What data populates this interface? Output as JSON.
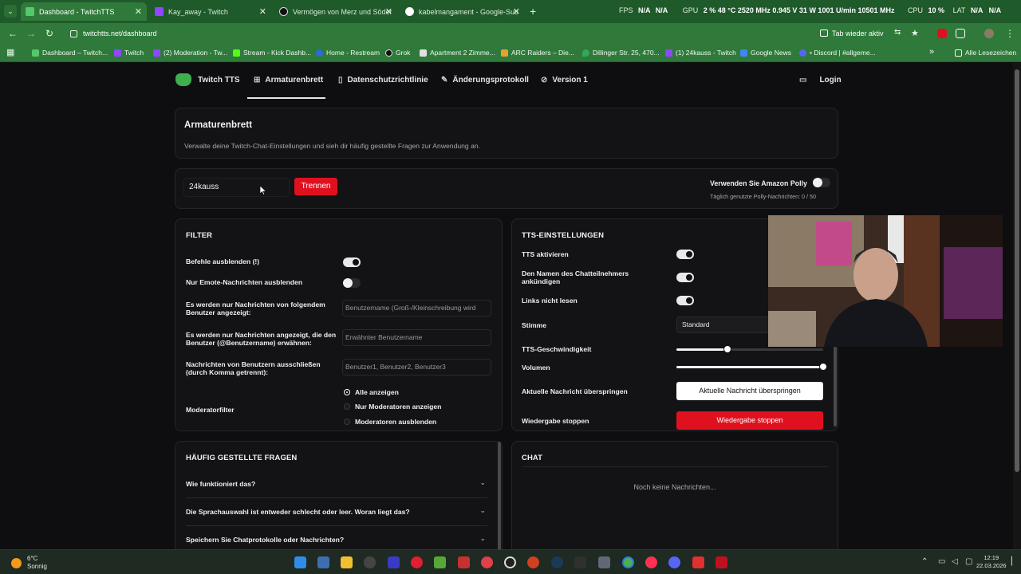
{
  "browser": {
    "tabs": [
      {
        "title": "Dashboard - TwitchTTS",
        "active": true
      },
      {
        "title": "Kay_away - Twitch"
      },
      {
        "title": "Vermögen von Merz und Söder"
      },
      {
        "title": "kabelmangament - Google-Suc"
      }
    ],
    "overlay": {
      "fps_label": "FPS",
      "fps_a": "N/A",
      "fps_b": "N/A",
      "gpu_label": "GPU",
      "gpu_line": "2 %  48 °C  2520 MHz  0.945 V  31 W  1001 U/min  10501 MHz",
      "cpu_label": "CPU",
      "cpu_val": "10 %",
      "lat_label": "LAT",
      "lat_a": "N/A",
      "lat_b": "N/A"
    },
    "url": "twitchtts.net/dashboard",
    "tab_active_label": "Tab wieder aktiv",
    "bookmarks": [
      "Dashboard – Twitch...",
      "Twitch",
      "(2) Moderation - Tw...",
      "Stream - Kick Dashb...",
      "Home - Restream",
      "Grok",
      "Apartment 2 Zimme...",
      "ARC Raiders – Die...",
      "Dillinger Str. 25, 470...",
      "(1) 24kauss - Twitch",
      "Google News",
      "• Discord | #allgeme..."
    ],
    "all_bookmarks": "Alle Lesezeichen"
  },
  "nav": {
    "brand": "Twitch TTS",
    "items": [
      "Armaturenbrett",
      "Datenschutzrichtlinie",
      "Änderungsprotokoll",
      "Version 1"
    ],
    "login": "Login"
  },
  "header": {
    "title": "Armaturenbrett",
    "subtitle": "Verwalte deine Twitch-Chat-Einstellungen und sieh dir häufig gestellte Fragen zur Anwendung an."
  },
  "connect": {
    "channel_value": "24kauss",
    "disconnect_label": "Trennen",
    "polly_label": "Verwenden Sie Amazon Polly",
    "polly_usage": "Täglich genutzte Polly-Nachrichten: 0 / 50"
  },
  "filter": {
    "title": "FILTER",
    "hide_commands": "Befehle ausblenden (!)",
    "emote_only": "Nur Emote-Nachrichten ausblenden",
    "from_users_label": "Es werden nur Nachrichten von folgendem Benutzer angezeigt:",
    "from_users_placeholder": "Benutzername (Groß-/Kleinschreibung wird",
    "mention_label": "Es werden nur Nachrichten angezeigt, die den Benutzer (@Benutzername) erwähnen:",
    "mention_placeholder": "Erwähnter Benutzername",
    "exclude_label": "Nachrichten von Benutzern ausschließen (durch Komma getrennt):",
    "exclude_placeholder": "Benutzer1, Benutzer2, Benutzer3",
    "moderator_label": "Moderatorfilter",
    "moderator_options": [
      "Alle anzeigen",
      "Nur Moderatoren anzeigen",
      "Moderatoren ausblenden"
    ]
  },
  "tts": {
    "title": "TTS-EINSTELLUNGEN",
    "enable": "TTS aktivieren",
    "announce_name": "Den Namen des Chatteilnehmers ankündigen",
    "no_links": "Links nicht lesen",
    "voice_label": "Stimme",
    "voice_value": "Standard",
    "speed_label": "TTS-Geschwindigkeit",
    "speed_level": 0.35,
    "volume_label": "Volumen",
    "volume_level": 1.0,
    "skip_label": "Aktuelle Nachricht überspringen",
    "skip_button": "Aktuelle Nachricht überspringen",
    "stop_label": "Wiedergabe stoppen",
    "stop_button": "Wiedergabe stoppen"
  },
  "faq": {
    "title": "HÄUFIG GESTELLTE FRAGEN",
    "questions": [
      "Wie funktioniert das?",
      "Die Sprachauswahl ist entweder schlecht oder leer. Woran liegt das?",
      "Speichern Sie Chatprotokolle oder Nachrichten?"
    ]
  },
  "chat": {
    "title": "CHAT",
    "empty": "Noch keine Nachrichten..."
  },
  "taskbar": {
    "temp": "6°C",
    "weather": "Sonnig",
    "time": "12:19",
    "date": "22.03.2026"
  },
  "colors": {
    "accent_red": "#e0111f",
    "chrome_green": "#2f7a3a",
    "page_bg": "#0e0e10"
  }
}
